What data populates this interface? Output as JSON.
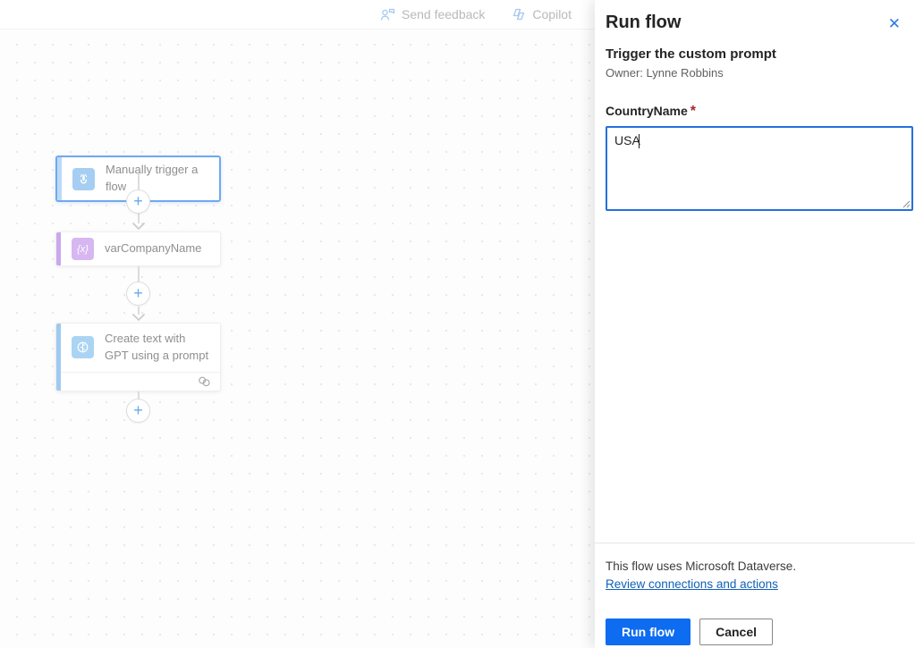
{
  "topbar": {
    "send_feedback_label": "Send feedback",
    "copilot_label": "Copilot"
  },
  "canvas": {
    "nodes": [
      {
        "title": "Manually trigger a flow"
      },
      {
        "title": "varCompanyName",
        "icon_glyph": "{x}"
      },
      {
        "title": "Create text with GPT using a prompt"
      }
    ]
  },
  "icons": {
    "add_glyph": "+",
    "close_glyph": "✕"
  },
  "panel": {
    "title": "Run flow",
    "flow_name": "Trigger the custom prompt",
    "owner": "Owner: Lynne Robbins",
    "field": {
      "label": "CountryName",
      "required_marker": "*",
      "value": "USA"
    },
    "dataverse_note": "This flow uses Microsoft Dataverse.",
    "review_link": "Review connections and actions",
    "run_button": "Run flow",
    "cancel_button": "Cancel"
  },
  "colors": {
    "accent_blue": "#0d6cf0",
    "selected_node_border": "#6fa9ee",
    "trigger_icon_bg": "#a5cef2",
    "trigger_accent_bar": "#bcd9f6",
    "variable_icon_bg": "#d7b7f2",
    "variable_accent_bar": "#c9a8ef",
    "gpt_icon_bg": "#abd4f3",
    "gpt_accent_bar": "#9fcaf0",
    "required_red": "#a4262c",
    "link_blue": "#1160b7"
  }
}
